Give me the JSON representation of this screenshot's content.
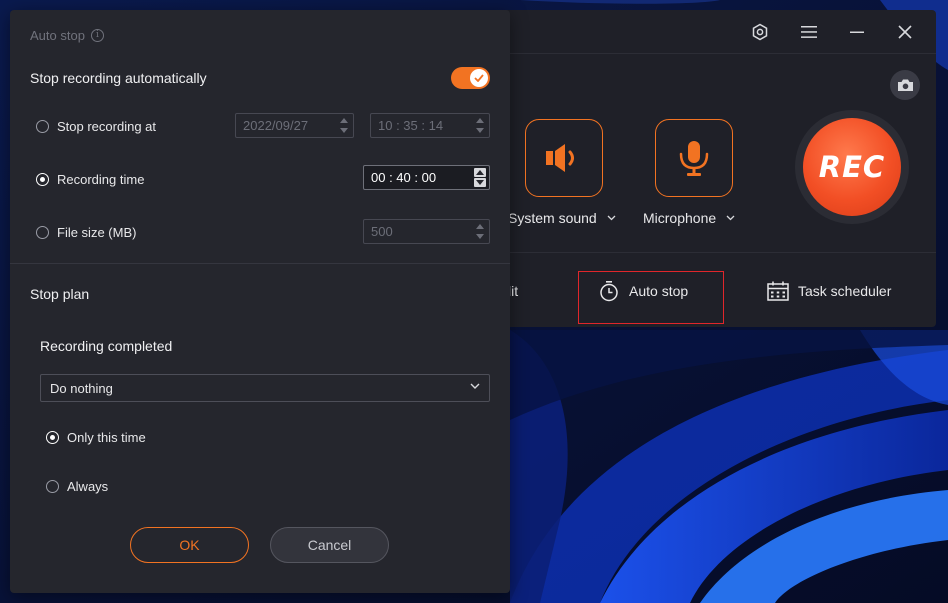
{
  "dialog": {
    "title": "Auto stop",
    "stop_auto_label": "Stop recording automatically",
    "stop_auto_enabled": true,
    "options": {
      "stop_at": {
        "label": "Stop recording at",
        "date": "2022/09/27",
        "time": "10 : 35 : 14",
        "selected": false
      },
      "recording_time": {
        "label": "Recording time",
        "value": "00 : 40 : 00",
        "selected": true
      },
      "file_size": {
        "label": "File size (MB)",
        "value": "500",
        "selected": false
      }
    },
    "stop_plan_label": "Stop plan",
    "recording_completed_label": "Recording completed",
    "action_select_value": "Do nothing",
    "frequency": {
      "only_this_time": {
        "label": "Only this time",
        "selected": true
      },
      "always": {
        "label": "Always",
        "selected": false
      }
    },
    "ok_label": "OK",
    "cancel_label": "Cancel"
  },
  "main_window": {
    "system_sound_label": "System sound",
    "microphone_label": "Microphone",
    "rec_label": "REC",
    "bottom_bar": {
      "split_partial_label": "lit",
      "auto_stop_label": "Auto stop",
      "task_scheduler_label": "Task scheduler"
    }
  },
  "colors": {
    "accent": "#f27322",
    "rec_button": "#f24f25",
    "highlight_box": "#e0262b",
    "dialog_bg": "#25262d",
    "window_bg": "#1f2028"
  }
}
